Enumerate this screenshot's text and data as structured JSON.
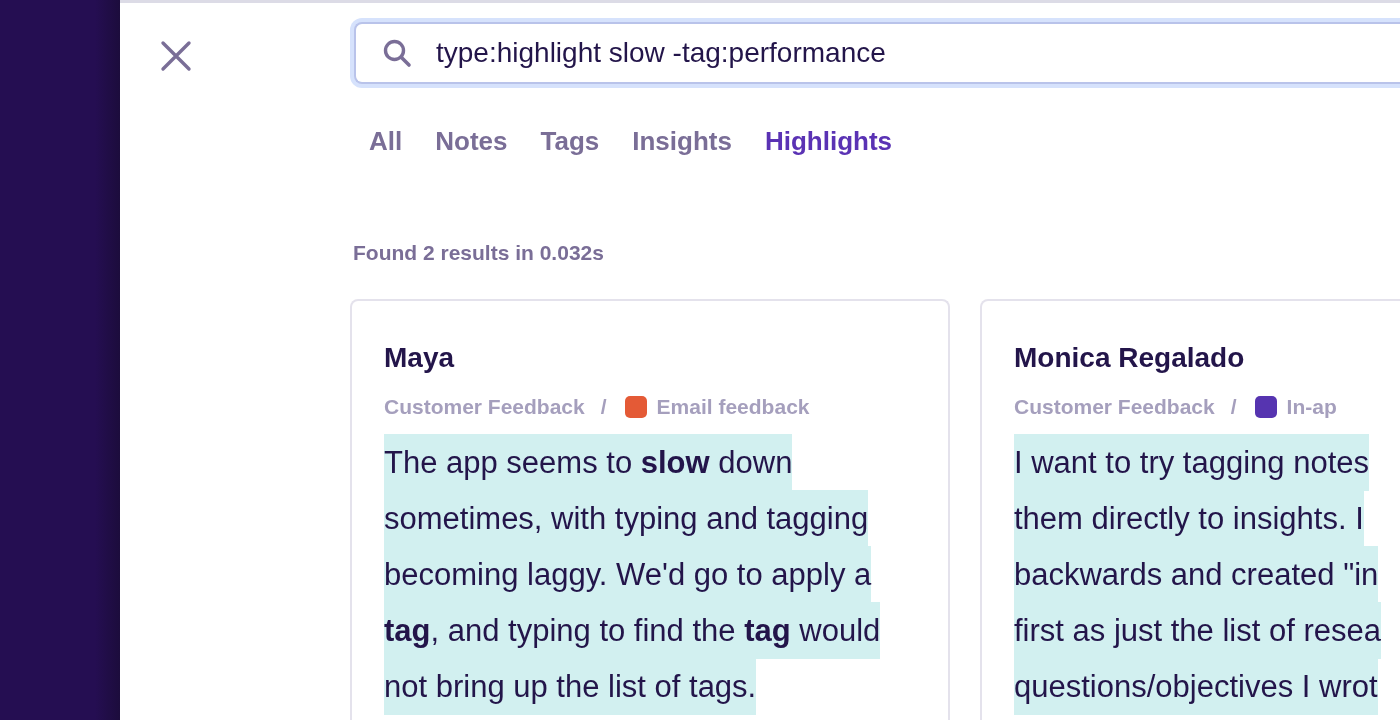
{
  "search": {
    "value": "type:highlight slow -tag:performance"
  },
  "tabs": [
    {
      "label": "All",
      "selected": false
    },
    {
      "label": "Notes",
      "selected": false
    },
    {
      "label": "Tags",
      "selected": false
    },
    {
      "label": "Insights",
      "selected": false
    },
    {
      "label": "Highlights",
      "selected": true
    }
  ],
  "results_summary": "Found 2 results in 0.032s",
  "results": [
    {
      "name": "Maya",
      "source": "Customer Feedback",
      "separator": "/",
      "tag": {
        "label": "Email feedback",
        "color": "#e45a36"
      },
      "lines": [
        "The app seems to **slow** down",
        "sometimes, with typing and tagging",
        "becoming laggy. We'd go to apply a",
        "**tag**, and typing to find the **tag** would",
        "not bring up the list of tags."
      ]
    },
    {
      "name": "Monica Regalado",
      "source": "Customer Feedback",
      "separator": "/",
      "tag": {
        "label": "In-ap",
        "color": "#5634b0"
      },
      "lines": [
        "I want to try tagging notes",
        "them directly to insights. I",
        "backwards and created \"in",
        "first as just the list of resea",
        "questions/objectives I wrot"
      ]
    }
  ]
}
